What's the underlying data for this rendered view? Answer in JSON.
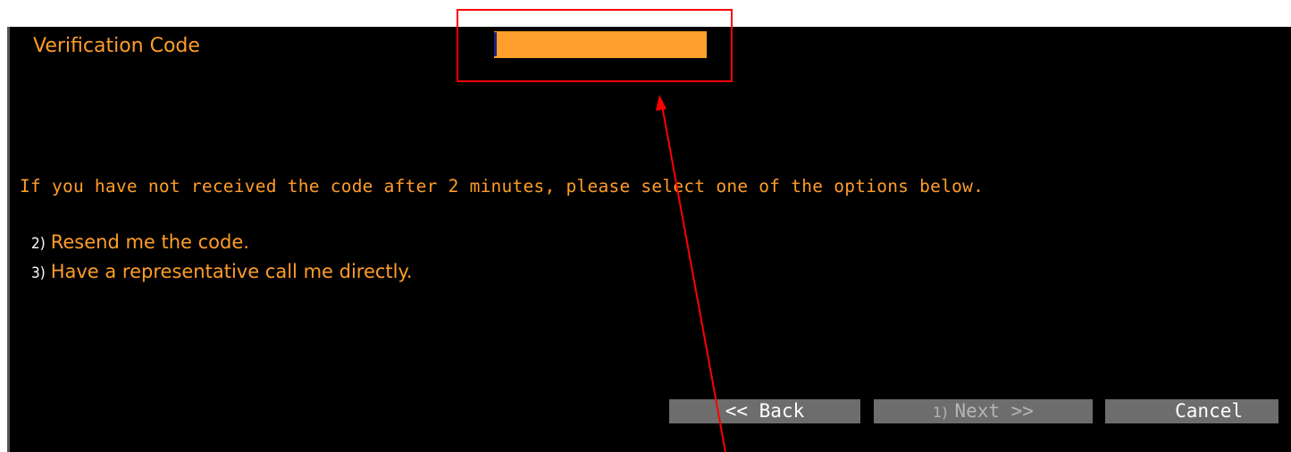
{
  "form": {
    "label": "Verification Code",
    "code_value": "",
    "message": "If you have not received the code after 2 minutes, please select one of the options below."
  },
  "options": [
    {
      "number": "2)",
      "text": "Resend me the code."
    },
    {
      "number": "3)",
      "text": "Have a representative call me directly."
    }
  ],
  "buttons": {
    "back": "<< Back",
    "next_number": "1)",
    "next": "Next >>",
    "cancel": "Cancel"
  },
  "colors": {
    "background": "#000000",
    "text_orange": "#ff9d2a",
    "input_orange": "#ffa02c",
    "button_gray": "#6d6d6d",
    "annotation_red": "#ff0000"
  }
}
